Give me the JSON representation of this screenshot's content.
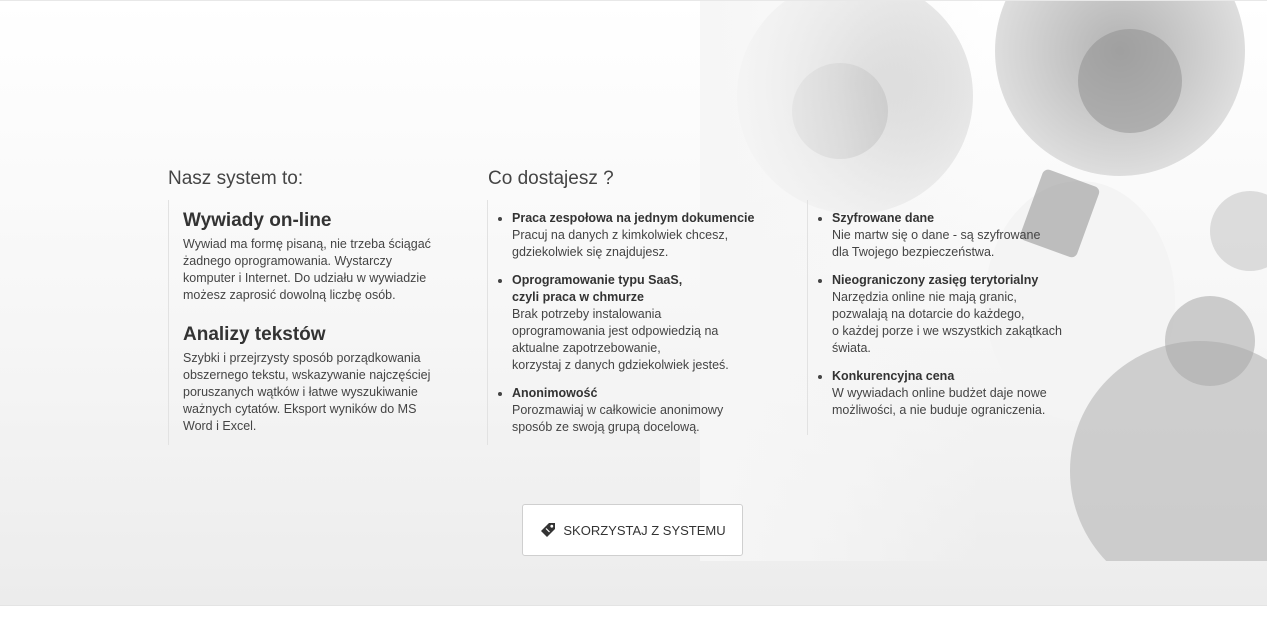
{
  "columns": {
    "left_title": "Nasz system to:",
    "middle_title": "Co dostajesz ?"
  },
  "features": [
    {
      "title": "Wywiady on-line",
      "lines": [
        "Wywiad ma formę pisaną, nie trzeba ściągać",
        "żadnego oprogramowania. Wystarczy",
        "komputer i Internet. Do udziału w wywiadzie",
        "możesz zaprosić dowolną liczbę osób."
      ]
    },
    {
      "title": "Analizy tekstów",
      "lines": [
        "Szybki i przejrzysty sposób porządkowania",
        "obszernego tekstu, wskazywanie najczęściej",
        "poruszanych wątków i łatwe wyszukiwanie",
        "ważnych cytatów. Eksport wyników do MS",
        "Word i Excel."
      ]
    }
  ],
  "benefits_middle": [
    {
      "title_lines": [
        "Praca zespołowa na jednym dokumencie"
      ],
      "text_lines": [
        "Pracuj na danych z kimkolwiek chcesz,",
        "gdziekolwiek się znajdujesz."
      ]
    },
    {
      "title_lines": [
        "Oprogramowanie typu SaaS,",
        "czyli praca w chmurze"
      ],
      "text_lines": [
        "Brak potrzeby instalowania",
        "oprogramowania jest odpowiedzią na",
        "aktualne zapotrzebowanie,",
        "korzystaj z danych gdziekolwiek jesteś."
      ]
    },
    {
      "title_lines": [
        "Anonimowość"
      ],
      "text_lines": [
        "Porozmawiaj w całkowicie anonimowy",
        "sposób ze swoją grupą docelową."
      ]
    }
  ],
  "benefits_right": [
    {
      "title_lines": [
        "Szyfrowane dane"
      ],
      "text_lines": [
        "Nie martw się o dane - są szyfrowane",
        "dla Twojego bezpieczeństwa."
      ]
    },
    {
      "title_lines": [
        "Nieograniczony zasięg terytorialny"
      ],
      "text_lines": [
        "Narzędzia online nie mają granic,",
        "pozwalają na dotarcie do każdego,",
        "o każdej porze i we wszystkich zakątkach",
        "świata."
      ]
    },
    {
      "title_lines": [
        "Konkurencyjna cena"
      ],
      "text_lines": [
        "W wywiadach online budżet daje nowe",
        "możliwości, a nie buduje ograniczenia."
      ]
    }
  ],
  "cta": {
    "label": "SKORZYSTAJ Z SYSTEMU",
    "icon": "tag-icon"
  }
}
